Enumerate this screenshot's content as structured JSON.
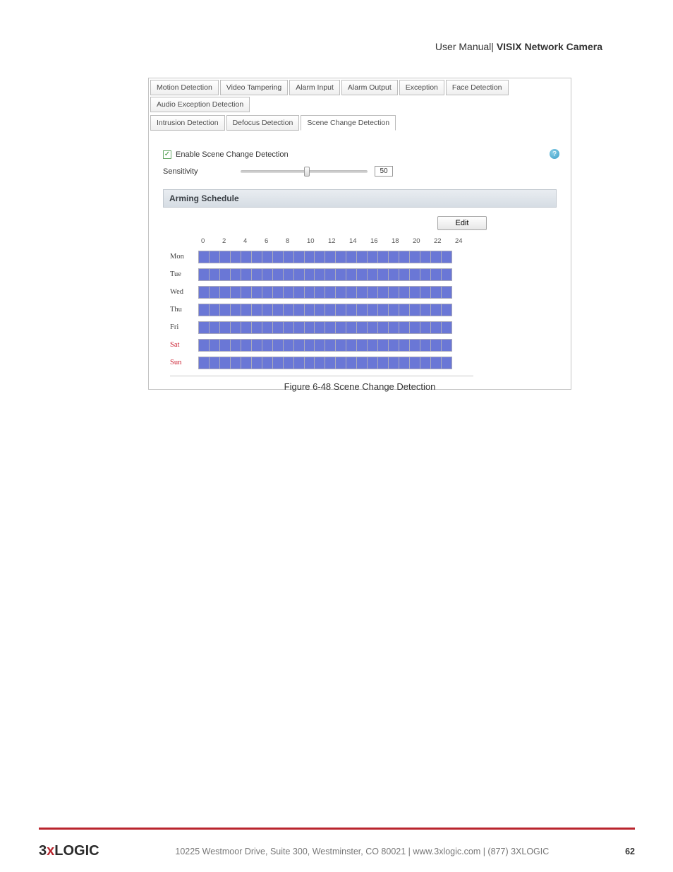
{
  "header": {
    "left": "User Manual|",
    "right": "VISIX Network Camera"
  },
  "tabs_row1": [
    "Motion Detection",
    "Video Tampering",
    "Alarm Input",
    "Alarm Output",
    "Exception",
    "Face Detection",
    "Audio Exception Detection"
  ],
  "tabs_row2": [
    "Intrusion Detection",
    "Defocus Detection",
    "Scene Change Detection"
  ],
  "active_tab": "Scene Change Detection",
  "enable": {
    "label": "Enable Scene Change Detection",
    "checked": true
  },
  "sensitivity": {
    "label": "Sensitivity",
    "value": "50"
  },
  "section": "Arming Schedule",
  "edit_label": "Edit",
  "hours": [
    "0",
    "2",
    "4",
    "6",
    "8",
    "10",
    "12",
    "14",
    "16",
    "18",
    "20",
    "22",
    "24"
  ],
  "days": [
    {
      "label": "Mon",
      "weekend": false
    },
    {
      "label": "Tue",
      "weekend": false
    },
    {
      "label": "Wed",
      "weekend": false
    },
    {
      "label": "Thu",
      "weekend": false
    },
    {
      "label": "Fri",
      "weekend": false
    },
    {
      "label": "Sat",
      "weekend": true
    },
    {
      "label": "Sun",
      "weekend": true
    }
  ],
  "caption": {
    "prefix": "Figure 6-48 ",
    "title": "Scene Change Detection"
  },
  "footer": {
    "logo_a": "3",
    "logo_x": "x",
    "logo_b": "LOGIC",
    "text": "10225 Westmoor Drive, Suite 300, Westminster, CO 80021 | www.3xlogic.com | (877) 3XLOGIC",
    "page": "62"
  }
}
